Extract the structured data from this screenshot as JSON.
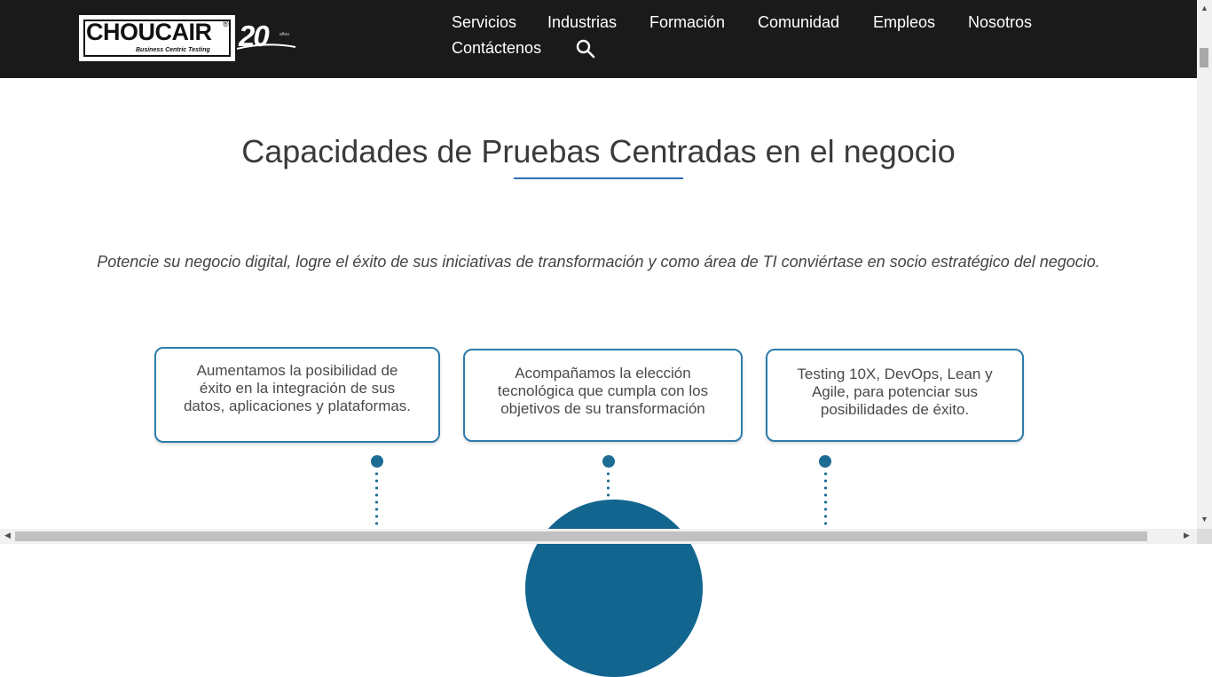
{
  "brand": {
    "name": "CHOUCAIR",
    "registered_mark": "®",
    "tagline": "Business Centric Testing",
    "anniversary": "20",
    "anniversary_small": "años"
  },
  "nav": {
    "items": [
      "Servicios",
      "Industrias",
      "Formación",
      "Comunidad",
      "Empleos",
      "Nosotros",
      "Contáctenos"
    ],
    "search_icon": "search-icon"
  },
  "main": {
    "heading": "Capacidades de Pruebas Centradas en el negocio",
    "subtitle": "Potencie su negocio digital, logre el éxito de sus iniciativas de transformación y como área de TI conviértase en socio estratégico del negocio.",
    "cards": [
      {
        "lines": [
          "Aumentamos la posibilidad de",
          "éxito en la integración de sus",
          "datos, aplicaciones y plataformas."
        ]
      },
      {
        "lines": [
          "Acompañamos la elección",
          "tecnológica que cumpla con los",
          "objetivos de su transformación"
        ]
      },
      {
        "lines": [
          "Testing 10X, DevOps, Lean y",
          "Agile, para potenciar sus",
          "posibilidades de éxito."
        ]
      }
    ]
  },
  "colors": {
    "navbar_bg": "#1a1a1a",
    "accent": "#2f6fb5",
    "card_border": "#2d7cab",
    "connector": "#1d6c95"
  }
}
